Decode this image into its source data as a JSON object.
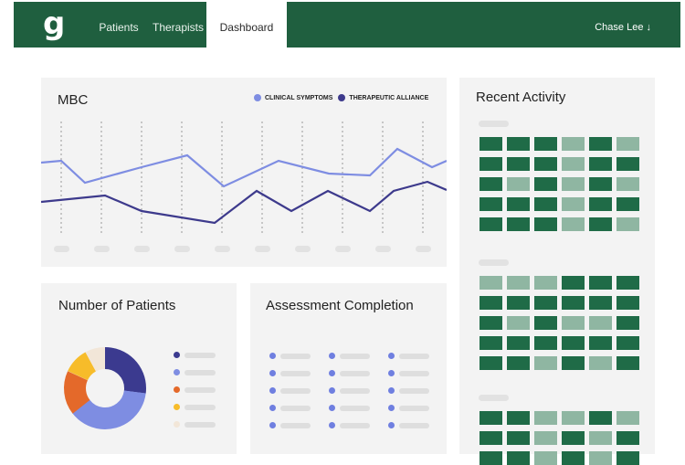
{
  "app": {
    "logo": "g"
  },
  "nav": {
    "items": [
      {
        "label": "Patients",
        "active": false
      },
      {
        "label": "Therapists",
        "active": false
      },
      {
        "label": "Dashboard",
        "active": true
      }
    ],
    "user": "Chase Lee ↓"
  },
  "mbc": {
    "title": "MBC",
    "legend": [
      {
        "label": "CLINICAL SYMPTOMS",
        "color": "#7e8de2"
      },
      {
        "label": "THERAPEUTIC ALLIANCE",
        "color": "#3d3a8c"
      }
    ]
  },
  "recent_activity": {
    "title": "Recent Activity"
  },
  "patients": {
    "title": "Number of Patients",
    "donut_colors": [
      "#3b3a8f",
      "#7e8de2",
      "#e4692a",
      "#f7bc2a",
      "#f2e6d8"
    ]
  },
  "assessment": {
    "title": "Assessment Completion"
  },
  "colors": {
    "brand": "#1f5f3f",
    "dark_cell": "#1f6b47",
    "light_cell": "#8fb6a2"
  }
}
